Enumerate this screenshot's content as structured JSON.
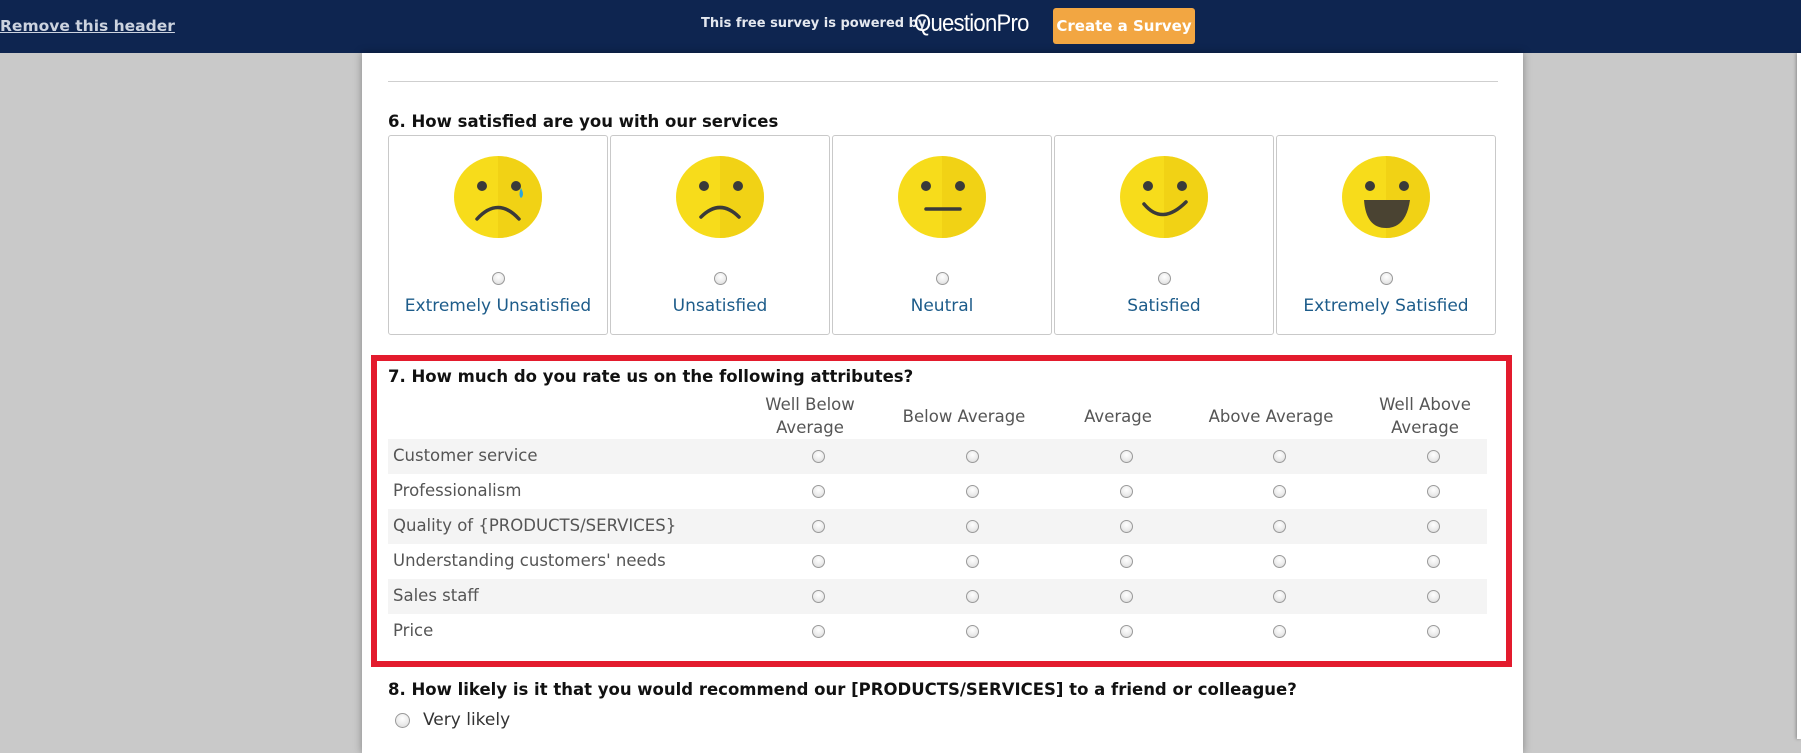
{
  "header": {
    "remove_link": "Remove this header",
    "powered_text": "This free survey is powered by",
    "brand": "QuestionPro",
    "cta_label": "Create a Survey"
  },
  "q6": {
    "title": "6. How satisfied are you with our services",
    "options": [
      {
        "label": "Extremely Unsatisfied",
        "icon": "crying-face-icon"
      },
      {
        "label": "Unsatisfied",
        "icon": "sad-face-icon"
      },
      {
        "label": "Neutral",
        "icon": "neutral-face-icon"
      },
      {
        "label": "Satisfied",
        "icon": "smiling-face-icon"
      },
      {
        "label": "Extremely Satisfied",
        "icon": "laughing-face-icon"
      }
    ]
  },
  "q7": {
    "title": "7. How much do you rate us on the following attributes?",
    "columns": [
      [
        "Well Below",
        "Average"
      ],
      [
        "Below Average"
      ],
      [
        "Average"
      ],
      [
        "Above Average"
      ],
      [
        "Well Above",
        "Average"
      ]
    ],
    "rows": [
      "Customer service",
      "Professionalism",
      "Quality of {PRODUCTS/SERVICES}",
      "Understanding customers' needs",
      "Sales staff",
      "Price"
    ]
  },
  "q8": {
    "title": "8. How likely is it that you would recommend our [PRODUCTS/SERVICES] to a friend or colleague?",
    "first_option": "Very likely"
  },
  "colors": {
    "header_bg": "#0e2550",
    "cta_bg": "#f2a642",
    "highlight_border": "#e31b2d",
    "smiley_label": "#1d5c8a",
    "smiley_face": "#f7dc1b"
  }
}
